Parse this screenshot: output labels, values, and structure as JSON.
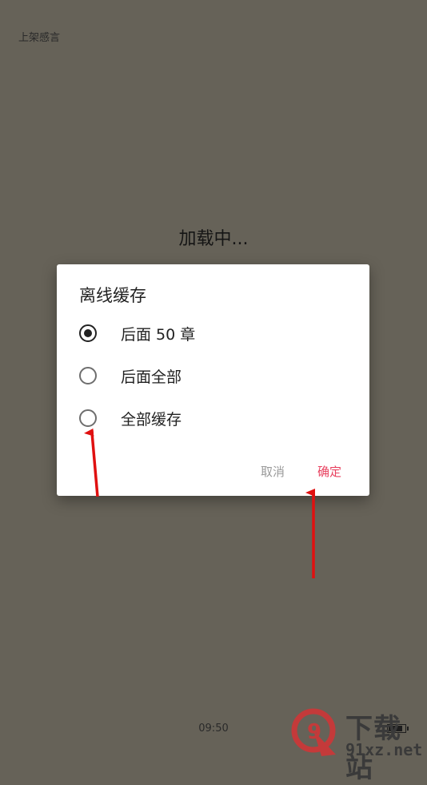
{
  "reader": {
    "title": "上架感言",
    "loading_text": "加载中..."
  },
  "dialog": {
    "title": "离线缓存",
    "options": [
      {
        "label": "后面 50 章",
        "checked": true
      },
      {
        "label": "后面全部",
        "checked": false
      },
      {
        "label": "全部缓存",
        "checked": false
      }
    ],
    "cancel_label": "取消",
    "confirm_label": "确定"
  },
  "status": {
    "time": "09:50",
    "battery_level": 0.9
  },
  "watermark": {
    "logo_text": "9",
    "text_top": "下载站",
    "text_bottom": "91xz.net"
  },
  "colors": {
    "background": "#666258",
    "accent": "#e8415f",
    "annotation_arrow": "#e01010"
  }
}
